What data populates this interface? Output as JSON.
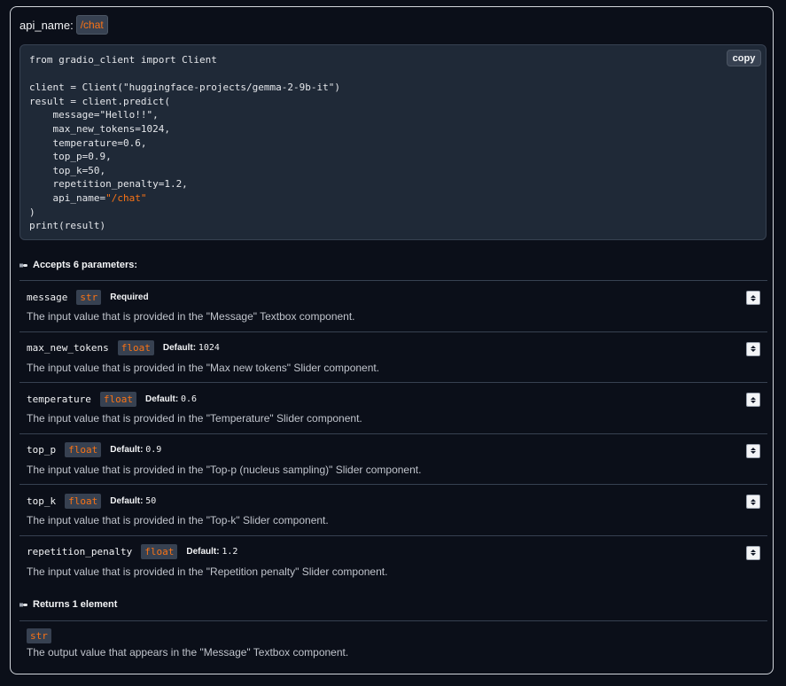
{
  "api": {
    "label": "api_name:",
    "name": "/chat"
  },
  "code": {
    "line1": "from gradio_client import Client",
    "line2": "",
    "line3": "client = Client(\"huggingface-projects/gemma-2-9b-it\")",
    "line4": "result = client.predict(",
    "line5": "    message=\"Hello!!\",",
    "line6": "    max_new_tokens=1024,",
    "line7": "    temperature=0.6,",
    "line8": "    top_p=0.9,",
    "line9": "    top_k=50,",
    "line10": "    repetition_penalty=1.2,",
    "line11_prefix": "    api_name=",
    "line11_value": "\"/chat\"",
    "line12": ")",
    "line13": "print(result)",
    "copy_label": "copy"
  },
  "accepts": {
    "title": "Accepts 6 parameters:"
  },
  "params": [
    {
      "name": "message",
      "type": "str",
      "extra_label": "Required",
      "default": "",
      "desc": "The input value that is provided in the \"Message\" Textbox component."
    },
    {
      "name": "max_new_tokens",
      "type": "float",
      "extra_label": "Default:",
      "default": "1024",
      "desc": "The input value that is provided in the \"Max new tokens\" Slider component."
    },
    {
      "name": "temperature",
      "type": "float",
      "extra_label": "Default:",
      "default": "0.6",
      "desc": "The input value that is provided in the \"Temperature\" Slider component."
    },
    {
      "name": "top_p",
      "type": "float",
      "extra_label": "Default:",
      "default": "0.9",
      "desc": "The input value that is provided in the \"Top-p (nucleus sampling)\" Slider component."
    },
    {
      "name": "top_k",
      "type": "float",
      "extra_label": "Default:",
      "default": "50",
      "desc": "The input value that is provided in the \"Top-k\" Slider component."
    },
    {
      "name": "repetition_penalty",
      "type": "float",
      "extra_label": "Default:",
      "default": "1.2",
      "desc": "The input value that is provided in the \"Repetition penalty\" Slider component."
    }
  ],
  "returns": {
    "title": "Returns 1 element",
    "type": "str",
    "desc": "The output value that appears in the \"Message\" Textbox component."
  },
  "colors": {
    "accent": "#f97316",
    "background": "#0b0f19",
    "code_bg": "#1f2937"
  },
  "icons": {
    "section": "collapse-toggle-icon",
    "stepper": "stepper-icon"
  }
}
